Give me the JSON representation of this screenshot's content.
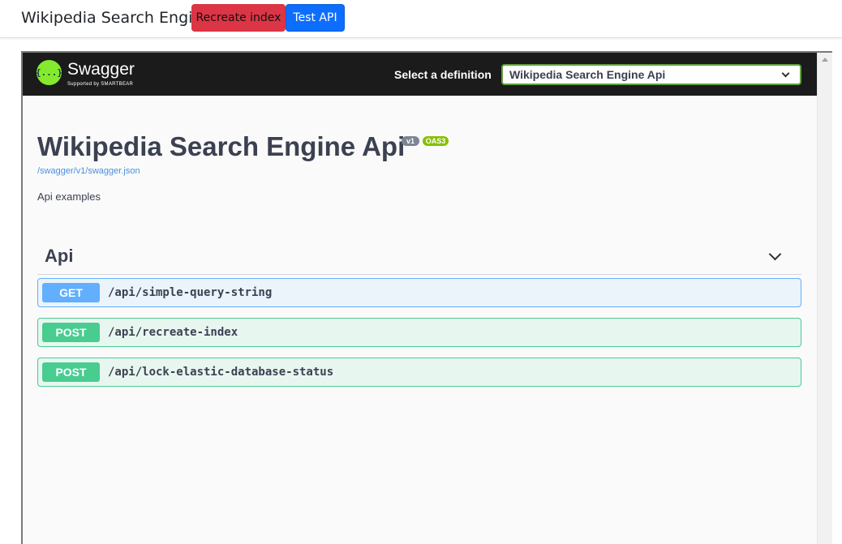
{
  "navbar": {
    "brand": "Wikipedia Search Engine",
    "buttons": [
      {
        "label": "Recreate index",
        "color": "#dc3545"
      },
      {
        "label": "Test API",
        "color": "#0d6efd"
      }
    ]
  },
  "swagger": {
    "logo_text": "Swagger",
    "logo_glyph": "{...}",
    "logo_sub": "Supported by SMARTBEAR",
    "select_label": "Select a definition",
    "selected_definition": "Wikipedia Search Engine Api"
  },
  "info": {
    "title": "Wikipedia Search Engine Api",
    "version_badge": "v1",
    "oas_badge": "OAS3",
    "spec_url": "/swagger/v1/swagger.json",
    "description": "Api examples"
  },
  "tag": {
    "name": "Api",
    "operations": [
      {
        "method": "GET",
        "path": "/api/simple-query-string",
        "color": "#61affe"
      },
      {
        "method": "POST",
        "path": "/api/recreate-index",
        "color": "#49cc90"
      },
      {
        "method": "POST",
        "path": "/api/lock-elastic-database-status",
        "color": "#49cc90"
      }
    ]
  }
}
